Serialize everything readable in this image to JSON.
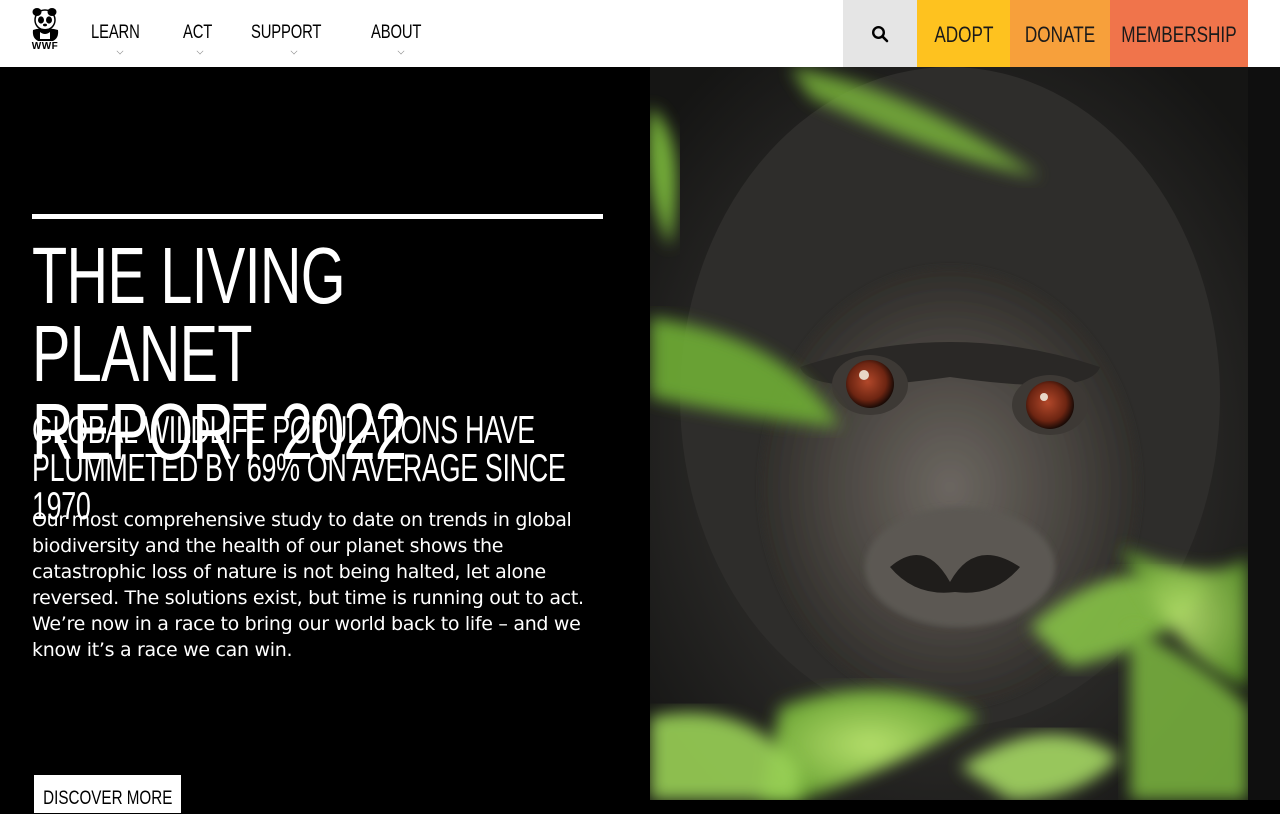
{
  "brand": {
    "logo_text": "WWF"
  },
  "nav": {
    "items": [
      {
        "label": "LEARN"
      },
      {
        "label": "ACT"
      },
      {
        "label": "SUPPORT"
      },
      {
        "label": "ABOUT"
      }
    ]
  },
  "header_actions": {
    "search_icon": "search-icon",
    "adopt": {
      "label": "ADOPT",
      "color": "#fec21f"
    },
    "donate": {
      "label": "DONATE",
      "color": "#f7a03b"
    },
    "membership": {
      "label": "MEMBERSHIP",
      "color": "#f0744b"
    }
  },
  "hero": {
    "title_line1": "THE LIVING PLANET",
    "title_line2": "REPORT 2022",
    "subtitle_line1": "GLOBAL WILDLIFE POPULATIONS HAVE",
    "subtitle_line2": "PLUMMETED BY 69% ON AVERAGE SINCE 1970",
    "body": "Our most comprehensive study to date on trends in global biodiversity and the health of our planet shows the catastrophic loss of nature is not being halted, let alone reversed. The solutions exist, but time is running out to act. We’re now in a race to bring our world back to life – and we know it’s a race we can win.",
    "cta_label": "DISCOVER MORE"
  }
}
